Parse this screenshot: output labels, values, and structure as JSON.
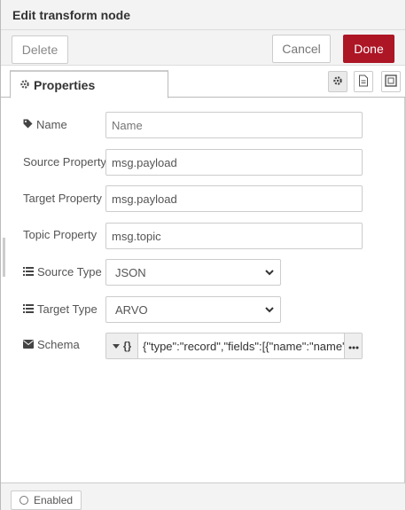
{
  "header": {
    "title": "Edit transform node"
  },
  "toolbar": {
    "delete_label": "Delete",
    "cancel_label": "Cancel",
    "done_label": "Done"
  },
  "tabs": {
    "properties_label": "Properties"
  },
  "form": {
    "name": {
      "label": "Name",
      "value": "",
      "placeholder": "Name"
    },
    "source_property": {
      "label": "Source Property",
      "value": "msg.payload"
    },
    "target_property": {
      "label": "Target Property",
      "value": "msg.payload"
    },
    "topic_property": {
      "label": "Topic Property",
      "value": "msg.topic"
    },
    "source_type": {
      "label": "Source Type",
      "value": "JSON"
    },
    "target_type": {
      "label": "Target Type",
      "value": "ARVO"
    },
    "schema": {
      "label": "Schema",
      "type_glyph": "{}",
      "value": "{\"type\":\"record\",\"fields\":[{\"name\":\"name\",\""
    }
  },
  "footer": {
    "enabled_label": "Enabled"
  },
  "colors": {
    "done_bg": "#ad1625",
    "header_bg": "#f3f3f3"
  }
}
